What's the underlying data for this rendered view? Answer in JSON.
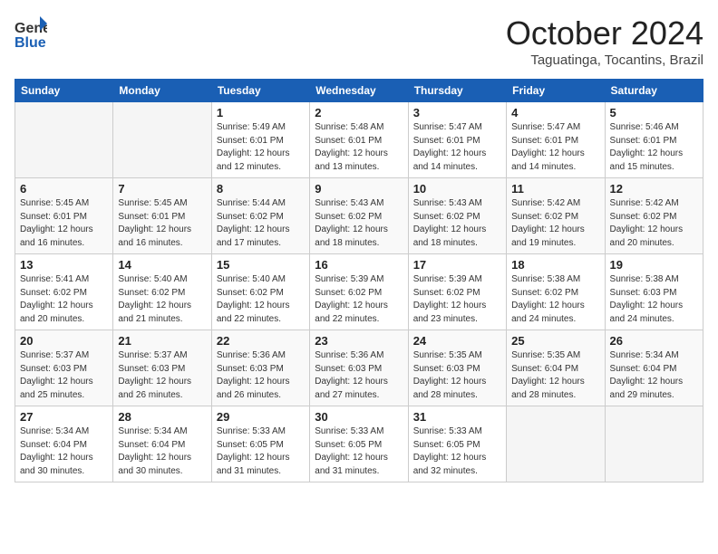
{
  "logo": {
    "line1": "General",
    "line2": "Blue"
  },
  "title": "October 2024",
  "location": "Taguatinga, Tocantins, Brazil",
  "days_of_week": [
    "Sunday",
    "Monday",
    "Tuesday",
    "Wednesday",
    "Thursday",
    "Friday",
    "Saturday"
  ],
  "weeks": [
    [
      {
        "day": "",
        "info": ""
      },
      {
        "day": "",
        "info": ""
      },
      {
        "day": "1",
        "info": "Sunrise: 5:49 AM\nSunset: 6:01 PM\nDaylight: 12 hours\nand 12 minutes."
      },
      {
        "day": "2",
        "info": "Sunrise: 5:48 AM\nSunset: 6:01 PM\nDaylight: 12 hours\nand 13 minutes."
      },
      {
        "day": "3",
        "info": "Sunrise: 5:47 AM\nSunset: 6:01 PM\nDaylight: 12 hours\nand 14 minutes."
      },
      {
        "day": "4",
        "info": "Sunrise: 5:47 AM\nSunset: 6:01 PM\nDaylight: 12 hours\nand 14 minutes."
      },
      {
        "day": "5",
        "info": "Sunrise: 5:46 AM\nSunset: 6:01 PM\nDaylight: 12 hours\nand 15 minutes."
      }
    ],
    [
      {
        "day": "6",
        "info": "Sunrise: 5:45 AM\nSunset: 6:01 PM\nDaylight: 12 hours\nand 16 minutes."
      },
      {
        "day": "7",
        "info": "Sunrise: 5:45 AM\nSunset: 6:01 PM\nDaylight: 12 hours\nand 16 minutes."
      },
      {
        "day": "8",
        "info": "Sunrise: 5:44 AM\nSunset: 6:02 PM\nDaylight: 12 hours\nand 17 minutes."
      },
      {
        "day": "9",
        "info": "Sunrise: 5:43 AM\nSunset: 6:02 PM\nDaylight: 12 hours\nand 18 minutes."
      },
      {
        "day": "10",
        "info": "Sunrise: 5:43 AM\nSunset: 6:02 PM\nDaylight: 12 hours\nand 18 minutes."
      },
      {
        "day": "11",
        "info": "Sunrise: 5:42 AM\nSunset: 6:02 PM\nDaylight: 12 hours\nand 19 minutes."
      },
      {
        "day": "12",
        "info": "Sunrise: 5:42 AM\nSunset: 6:02 PM\nDaylight: 12 hours\nand 20 minutes."
      }
    ],
    [
      {
        "day": "13",
        "info": "Sunrise: 5:41 AM\nSunset: 6:02 PM\nDaylight: 12 hours\nand 20 minutes."
      },
      {
        "day": "14",
        "info": "Sunrise: 5:40 AM\nSunset: 6:02 PM\nDaylight: 12 hours\nand 21 minutes."
      },
      {
        "day": "15",
        "info": "Sunrise: 5:40 AM\nSunset: 6:02 PM\nDaylight: 12 hours\nand 22 minutes."
      },
      {
        "day": "16",
        "info": "Sunrise: 5:39 AM\nSunset: 6:02 PM\nDaylight: 12 hours\nand 22 minutes."
      },
      {
        "day": "17",
        "info": "Sunrise: 5:39 AM\nSunset: 6:02 PM\nDaylight: 12 hours\nand 23 minutes."
      },
      {
        "day": "18",
        "info": "Sunrise: 5:38 AM\nSunset: 6:02 PM\nDaylight: 12 hours\nand 24 minutes."
      },
      {
        "day": "19",
        "info": "Sunrise: 5:38 AM\nSunset: 6:03 PM\nDaylight: 12 hours\nand 24 minutes."
      }
    ],
    [
      {
        "day": "20",
        "info": "Sunrise: 5:37 AM\nSunset: 6:03 PM\nDaylight: 12 hours\nand 25 minutes."
      },
      {
        "day": "21",
        "info": "Sunrise: 5:37 AM\nSunset: 6:03 PM\nDaylight: 12 hours\nand 26 minutes."
      },
      {
        "day": "22",
        "info": "Sunrise: 5:36 AM\nSunset: 6:03 PM\nDaylight: 12 hours\nand 26 minutes."
      },
      {
        "day": "23",
        "info": "Sunrise: 5:36 AM\nSunset: 6:03 PM\nDaylight: 12 hours\nand 27 minutes."
      },
      {
        "day": "24",
        "info": "Sunrise: 5:35 AM\nSunset: 6:03 PM\nDaylight: 12 hours\nand 28 minutes."
      },
      {
        "day": "25",
        "info": "Sunrise: 5:35 AM\nSunset: 6:04 PM\nDaylight: 12 hours\nand 28 minutes."
      },
      {
        "day": "26",
        "info": "Sunrise: 5:34 AM\nSunset: 6:04 PM\nDaylight: 12 hours\nand 29 minutes."
      }
    ],
    [
      {
        "day": "27",
        "info": "Sunrise: 5:34 AM\nSunset: 6:04 PM\nDaylight: 12 hours\nand 30 minutes."
      },
      {
        "day": "28",
        "info": "Sunrise: 5:34 AM\nSunset: 6:04 PM\nDaylight: 12 hours\nand 30 minutes."
      },
      {
        "day": "29",
        "info": "Sunrise: 5:33 AM\nSunset: 6:05 PM\nDaylight: 12 hours\nand 31 minutes."
      },
      {
        "day": "30",
        "info": "Sunrise: 5:33 AM\nSunset: 6:05 PM\nDaylight: 12 hours\nand 31 minutes."
      },
      {
        "day": "31",
        "info": "Sunrise: 5:33 AM\nSunset: 6:05 PM\nDaylight: 12 hours\nand 32 minutes."
      },
      {
        "day": "",
        "info": ""
      },
      {
        "day": "",
        "info": ""
      }
    ]
  ]
}
